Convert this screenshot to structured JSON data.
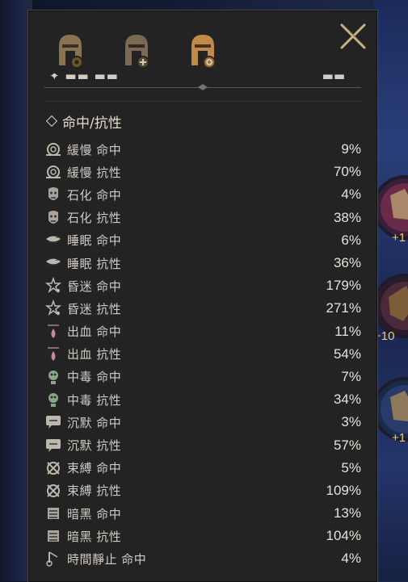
{
  "tabs": [
    {
      "icon": "helmet-gear-icon"
    },
    {
      "icon": "helmet-plus-icon"
    },
    {
      "icon": "helmet-shield-icon",
      "active": true
    }
  ],
  "section": {
    "title": "命中/抗性"
  },
  "rows": [
    {
      "label": "緩慢 命中",
      "value": "9%",
      "icon": "snail-icon"
    },
    {
      "label": "緩慢 抗性",
      "value": "70%",
      "icon": "snail-icon"
    },
    {
      "label": "石化 命中",
      "value": "4%",
      "icon": "stone-face-icon"
    },
    {
      "label": "石化 抗性",
      "value": "38%",
      "icon": "stone-face-icon"
    },
    {
      "label": "睡眠 命中",
      "value": "6%",
      "icon": "sleep-icon"
    },
    {
      "label": "睡眠 抗性",
      "value": "36%",
      "icon": "sleep-icon"
    },
    {
      "label": "昏迷 命中",
      "value": "179%",
      "icon": "stun-stars-icon"
    },
    {
      "label": "昏迷 抗性",
      "value": "271%",
      "icon": "stun-stars-icon"
    },
    {
      "label": "出血 命中",
      "value": "11%",
      "icon": "blood-drop-icon"
    },
    {
      "label": "出血 抗性",
      "value": "54%",
      "icon": "blood-drop-icon"
    },
    {
      "label": "中毒 命中",
      "value": "7%",
      "icon": "poison-skull-icon"
    },
    {
      "label": "中毒 抗性",
      "value": "34%",
      "icon": "poison-skull-icon"
    },
    {
      "label": "沉默 命中",
      "value": "3%",
      "icon": "speech-bubble-icon"
    },
    {
      "label": "沉默 抗性",
      "value": "57%",
      "icon": "speech-bubble-icon"
    },
    {
      "label": "束縛 命中",
      "value": "5%",
      "icon": "bind-cross-icon"
    },
    {
      "label": "束縛 抗性",
      "value": "109%",
      "icon": "bind-cross-icon"
    },
    {
      "label": "暗黑 命中",
      "value": "13%",
      "icon": "darkness-face-icon"
    },
    {
      "label": "暗黑 抗性",
      "value": "104%",
      "icon": "darkness-face-icon"
    },
    {
      "label": "時間靜止 命中",
      "value": "4%",
      "icon": "time-stop-icon"
    }
  ],
  "side_badges": [
    {
      "label": "+1"
    },
    {
      "label": "+10"
    },
    {
      "label": "+1"
    }
  ],
  "colors": {
    "panel": "#232323",
    "text": "#cfcbc3",
    "gold": "#c9a46a"
  }
}
